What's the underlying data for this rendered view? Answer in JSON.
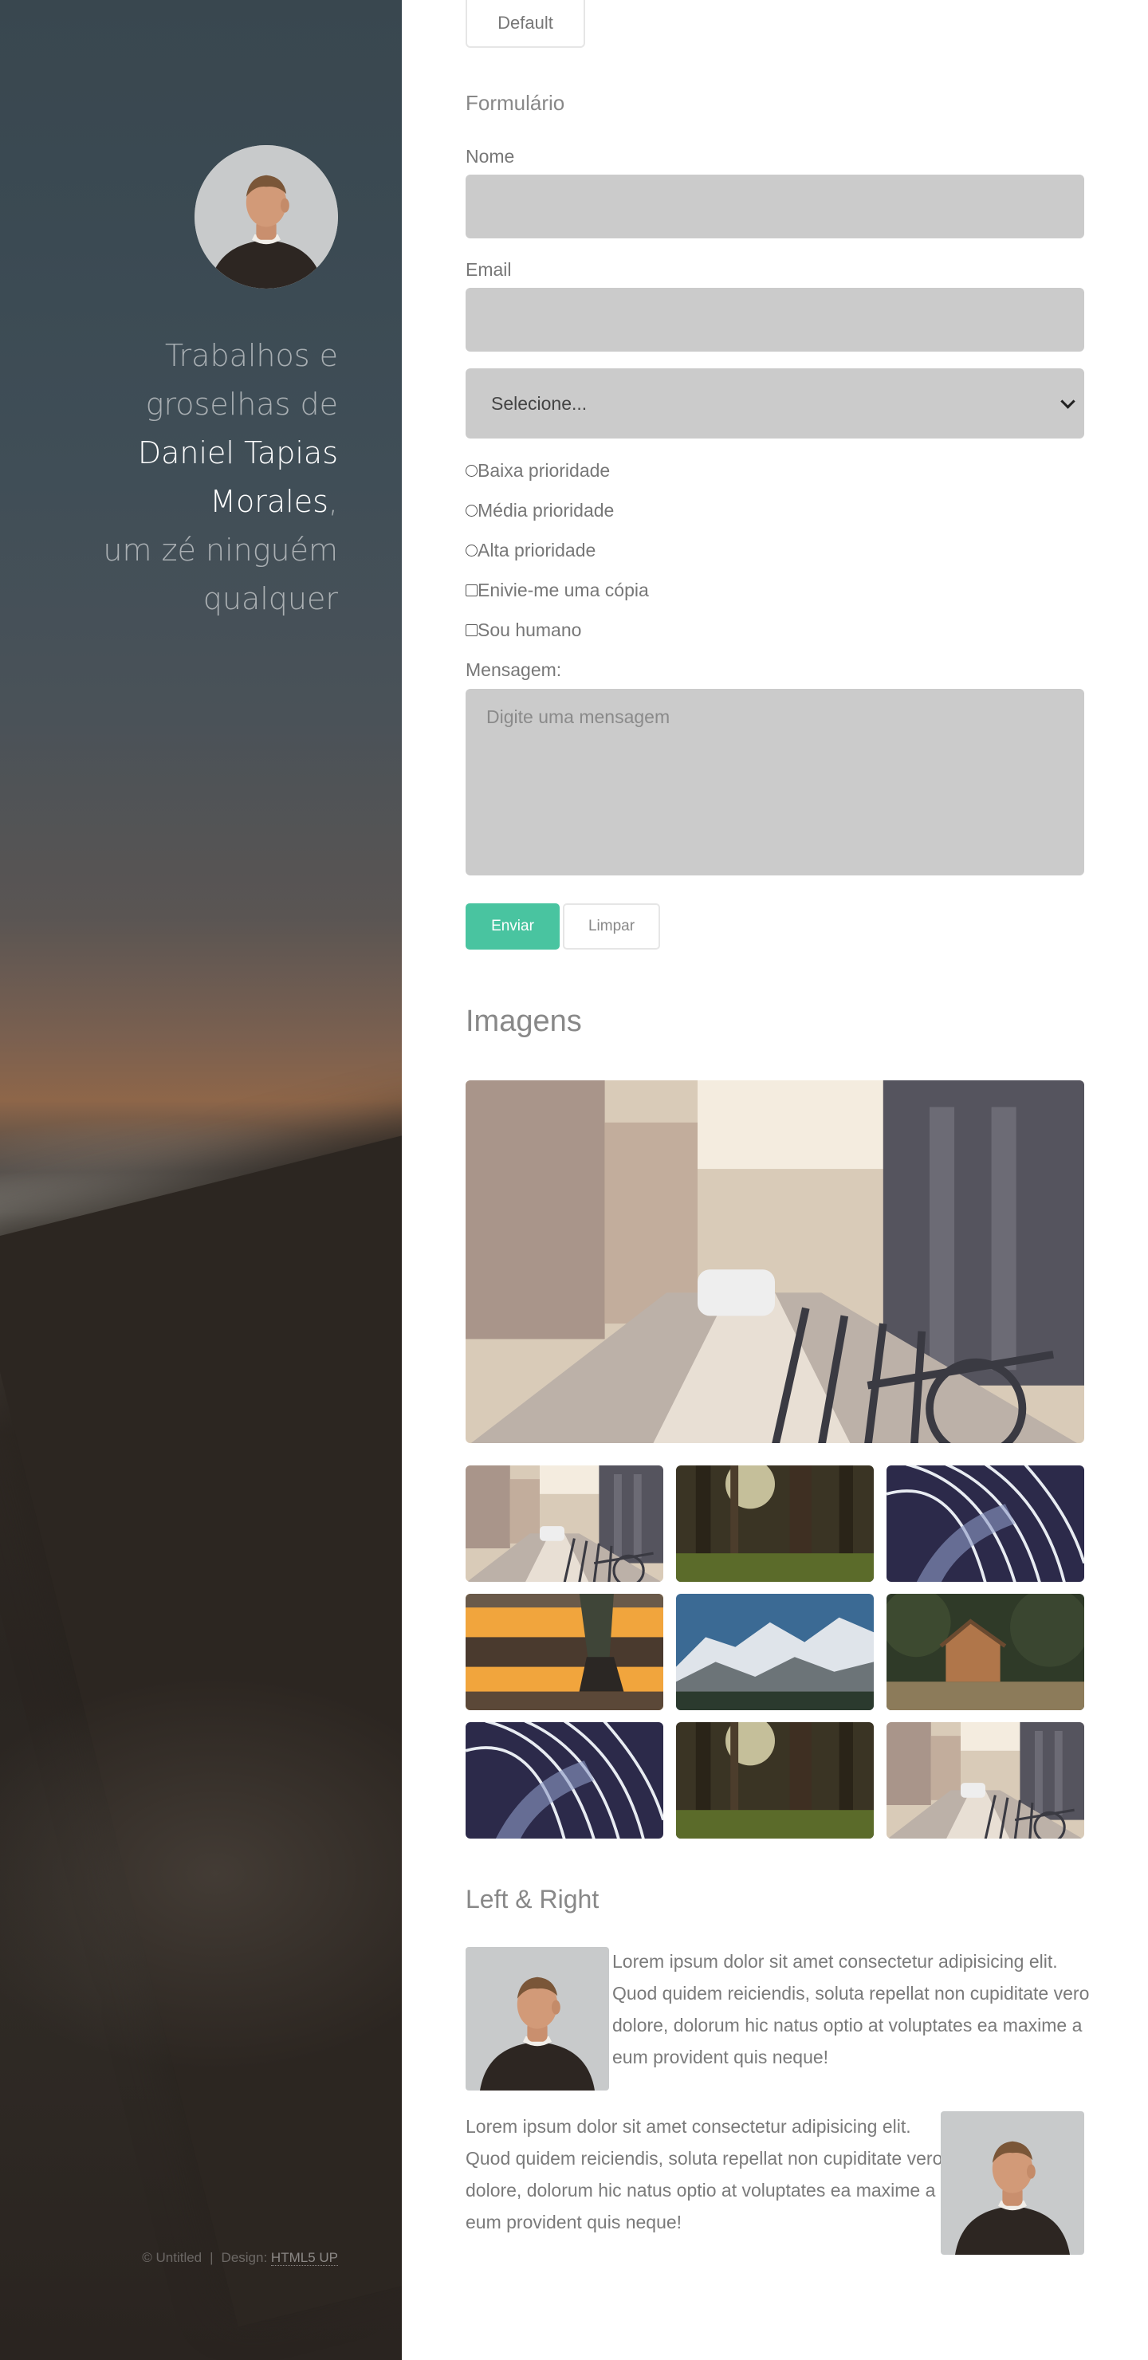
{
  "sidebar": {
    "tagline_line1": "Trabalhos e",
    "tagline_line2": "groselhas de",
    "name_line1": "Daniel Tapias",
    "name_line2": "Morales",
    "comma": ",",
    "tagline_line3": "um zé ninguém",
    "tagline_line4": "qualquer",
    "copyright": "© Untitled",
    "separator": "|",
    "design_label": "Design:",
    "design_link": "HTML5 UP"
  },
  "buttons": {
    "default_label": "Default"
  },
  "form": {
    "heading": "Formulário",
    "name_label": "Nome",
    "email_label": "Email",
    "select_value": "Selecione...",
    "priority_options": [
      "Baixa prioridade",
      "Média prioridade",
      "Alta prioridade"
    ],
    "copy_checkbox": "Enivie-me uma cópia",
    "human_checkbox": "Sou humano",
    "message_label": "Mensagem:",
    "message_placeholder": "Digite uma mensagem",
    "send_label": "Enviar",
    "clear_label": "Limpar"
  },
  "images": {
    "heading": "Imagens"
  },
  "left_right": {
    "heading": "Left & Right",
    "text_1": "Lorem ipsum dolor sit amet consectetur adipisicing elit. Quod quidem reiciendis, soluta repellat non cupiditate vero dolore, dolorum hic natus optio at voluptates ea maxime a eum provident quis neque!",
    "text_2": "Lorem ipsum dolor sit amet consectetur adipisicing elit. Quod quidem reiciendis, soluta repellat non cupiditate vero dolore, dolorum hic natus optio at voluptates ea maxime a eum provident quis neque!"
  },
  "colors": {
    "accent": "#49c4a0",
    "field_bg": "#cbcbcb"
  }
}
